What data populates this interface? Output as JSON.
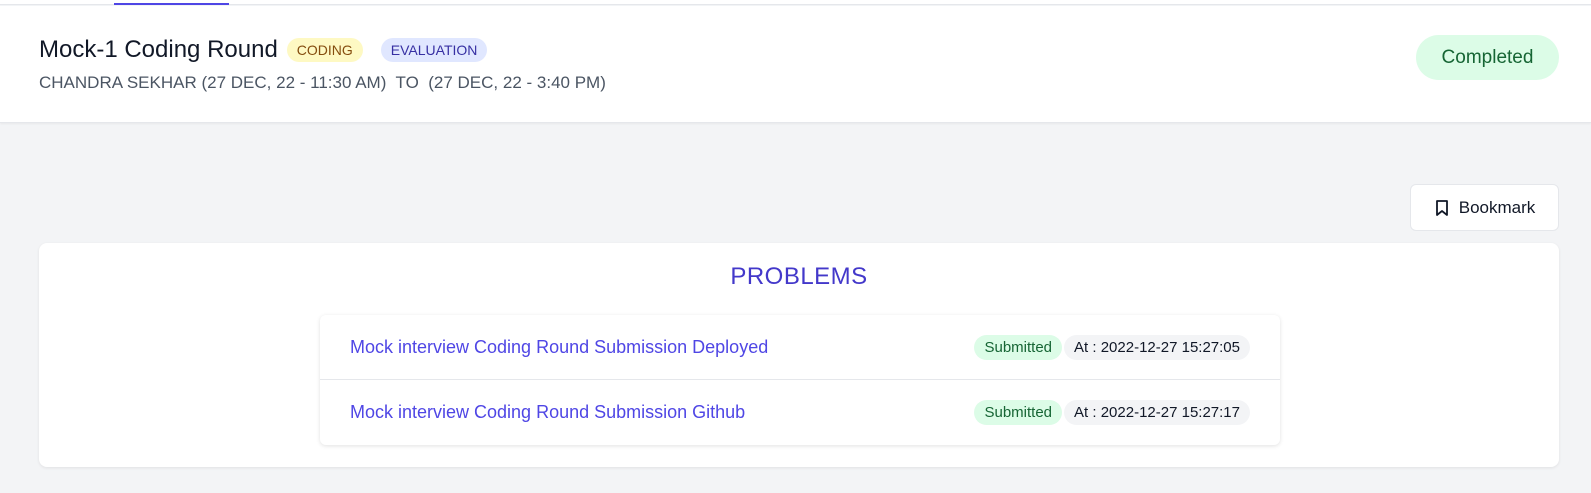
{
  "header": {
    "title": "Mock-1 Coding Round",
    "badges": [
      "CODING",
      "EVALUATION"
    ],
    "subtitle": "CHANDRA SEKHAR (27 DEC, 22 - 11:30 AM)  TO  (27 DEC, 22 - 3:40 PM)",
    "status": "Completed"
  },
  "toolbar": {
    "bookmark_label": "Bookmark",
    "bookmark_icon": "bookmark-icon"
  },
  "problems": {
    "heading": "PROBLEMS",
    "items": [
      {
        "title": "Mock interview Coding Round Submission Deployed",
        "status": "Submitted",
        "submitted_at": "At : 2022-12-27 15:27:05"
      },
      {
        "title": "Mock interview Coding Round Submission Github",
        "status": "Submitted",
        "submitted_at": "At : 2022-12-27 15:27:17"
      }
    ]
  },
  "colors": {
    "accent": "#4f46e5",
    "success_bg": "#dcfce7",
    "success_text": "#166534",
    "coding_badge_bg": "#fef9c3",
    "evaluation_badge_bg": "#e0e7ff"
  }
}
